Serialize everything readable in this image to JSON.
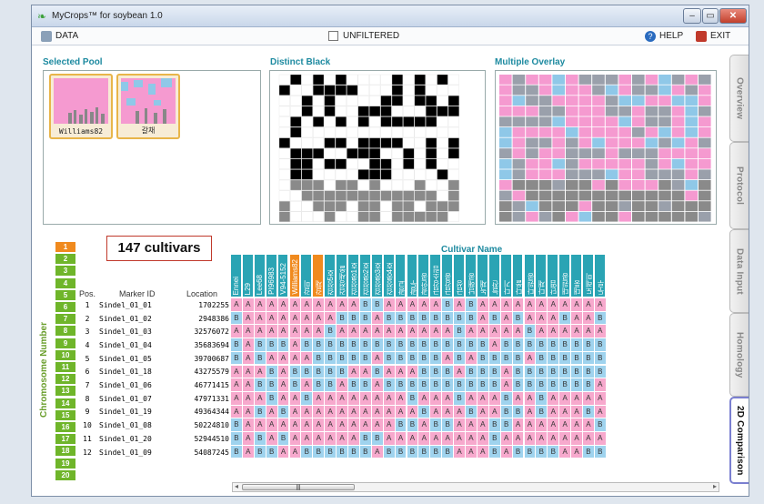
{
  "app": {
    "title": "MyCrops™ for soybean 1.0"
  },
  "toolbar": {
    "data_label": "DATA",
    "filter_label": "UNFILTERED",
    "help_label": "HELP",
    "exit_label": "EXIT"
  },
  "panels": {
    "selected_pool": "Selected Pool",
    "distinct_black": "Distinct Black",
    "multiple_overlay": "Multiple Overlay"
  },
  "pool": [
    {
      "name": "Williams82"
    },
    {
      "name": "갈채"
    }
  ],
  "side_tabs": [
    "Overview",
    "Protocol",
    "Data Input",
    "Homology",
    "2D Comparison"
  ],
  "cultivar_count": "147 cultivars",
  "cultivar_name_label": "Cultivar Name",
  "chromosome_label": "Chromosome Number",
  "chromosomes": [
    "1",
    "2",
    "3",
    "4",
    "5",
    "6",
    "7",
    "8",
    "9",
    "10",
    "11",
    "12",
    "13",
    "14",
    "15",
    "16",
    "17",
    "18",
    "19",
    "20"
  ],
  "selected_chromosome": "1",
  "table": {
    "headers": {
      "pos": "Pos.",
      "marker": "Marker ID",
      "location": "Location"
    },
    "cultivars": [
      "Ennei",
      "L29",
      "Lee68",
      "PI96983",
      "V94-5152",
      "Williams82",
      "갈미",
      "갈채",
      "검정5호",
      "검정새올",
      "검정콩1호",
      "검정콩2호",
      "검정콩3호",
      "검정콩4호",
      "광교",
      "광두",
      "광안콩",
      "금강소립",
      "금강콩",
      "금성",
      "남해콩",
      "녹채",
      "늘찬",
      "다기",
      "다올",
      "다원콩",
      "다채",
      "단엽",
      "대원콩",
      "대풍",
      "도레미",
      "두루"
    ],
    "selected_cultivars": [
      "Williams82",
      "갈채"
    ],
    "rows": [
      {
        "pos": "1",
        "marker": "Sindel_01_01",
        "location": "1702255",
        "calls": "AAAAAAAAAAABBAAAAABABAAAAAAAAAAA"
      },
      {
        "pos": "2",
        "marker": "Sindel_01_02",
        "location": "2948386",
        "calls": "BAAAAAAAABBBABBBBBBBBABABAAABAAB"
      },
      {
        "pos": "3",
        "marker": "Sindel_01_03",
        "location": "32576072",
        "calls": "AAAAAAAABAAAAAAAAAABAAAAABAAAAAA"
      },
      {
        "pos": "4",
        "marker": "Sindel_01_04",
        "location": "35683694",
        "calls": "BABBBABBBBBBBBBBBBBBBBABBBBBBBBB"
      },
      {
        "pos": "5",
        "marker": "Sindel_01_05",
        "location": "39700687",
        "calls": "BABAAAABBBBBABBBBBABABBBBABBBBBB"
      },
      {
        "pos": "6",
        "marker": "Sindel_01_18",
        "location": "43275579",
        "calls": "AAABABBBBBAABAAABBBABBBABBBBBBBB"
      },
      {
        "pos": "7",
        "marker": "Sindel_01_06",
        "location": "46771415",
        "calls": "AABBABABBABBABBBBBBBBBBABBBBBBBA"
      },
      {
        "pos": "8",
        "marker": "Sindel_01_07",
        "location": "47971331",
        "calls": "AAABAABAAAAAAAABAAABAAABAABAAAAA"
      },
      {
        "pos": "9",
        "marker": "Sindel_01_19",
        "location": "49364344",
        "calls": "AABABAAAAAAAAAAABAAABAABBABAAABA"
      },
      {
        "pos": "10",
        "marker": "Sindel_01_08",
        "location": "50224810",
        "calls": "BAAAAAAAAAAAAABBABBAAABBAAAAAAAB"
      },
      {
        "pos": "11",
        "marker": "Sindel_01_20",
        "location": "52944510",
        "calls": "BABABAAAAAABBAAAAAAAAABAAAAAAAAA"
      },
      {
        "pos": "12",
        "marker": "Sindel_01_09",
        "location": "54087245",
        "calls": "BABBAABBBBBBABBBBBBAAABABBBBAABB"
      }
    ]
  },
  "colors": {
    "allele_a": "#f7a9cd",
    "allele_b": "#9fd3ee",
    "cultivar_header": "#2aa4b4",
    "selected": "#f08a1e",
    "chromosome": "#6fb52a",
    "accent": "#1d8aa0"
  }
}
